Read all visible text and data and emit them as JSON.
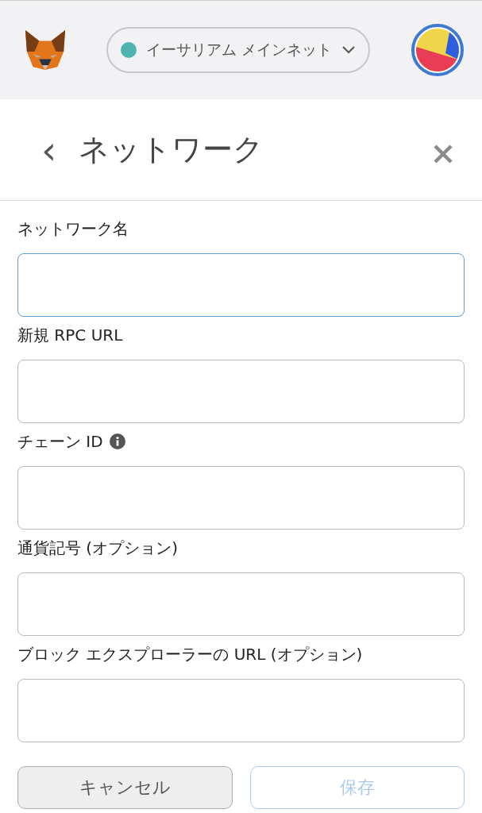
{
  "header": {
    "network": {
      "label": "イーサリアム メインネット",
      "color": "#4fb4ae"
    }
  },
  "page": {
    "back": "‹",
    "title": "ネットワーク"
  },
  "fields": [
    {
      "label": "ネットワーク名",
      "focused": true,
      "info": false
    },
    {
      "label": "新規 RPC URL",
      "focused": false,
      "info": false
    },
    {
      "label": "チェーン ID",
      "focused": false,
      "info": true
    },
    {
      "label": "通貨記号 (オプション)",
      "focused": false,
      "info": false
    },
    {
      "label": "ブロック エクスプローラーの URL (オプション)",
      "focused": false,
      "info": false
    }
  ],
  "buttons": [
    {
      "label": "キャンセル",
      "kind": "secondary",
      "disabled": false
    },
    {
      "label": "保存",
      "kind": "primary",
      "disabled": true
    }
  ]
}
